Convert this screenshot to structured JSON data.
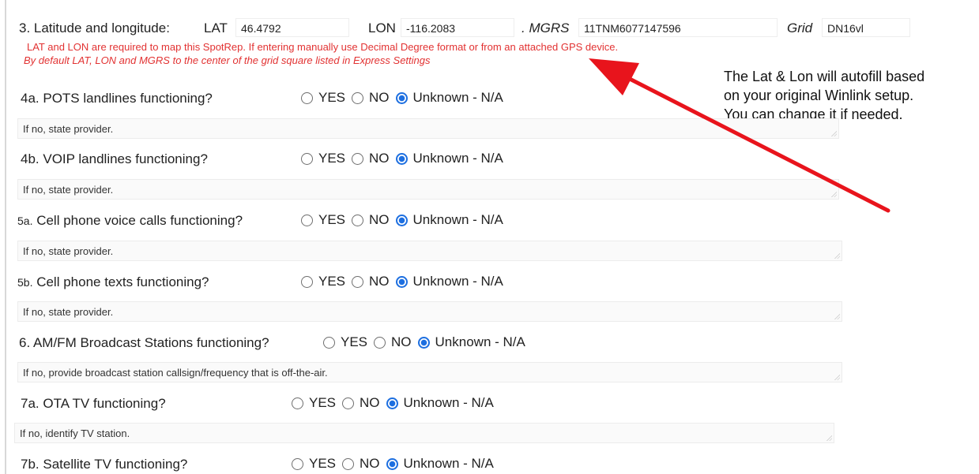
{
  "q3": {
    "label": "3. Latitude and longitude:",
    "lat_label": "LAT",
    "lat_value": "46.4792",
    "lon_label": "LON",
    "lon_value": "-116.2083",
    "mgrs_label": ". MGRS",
    "mgrs_value": "11TNM6077147596",
    "grid_label": "Grid",
    "grid_value": "DN16vl",
    "note1": "LAT and LON are required to map this SpotRep. If entering manually use Decimal Degree format or from an attached GPS device.",
    "note2": "By default  LAT, LON and MGRS to the center of the grid square listed in Express Settings"
  },
  "options": {
    "yes": "YES",
    "no": "NO",
    "unknown": "Unknown - N/A"
  },
  "questions": [
    {
      "label": "4a. POTS landlines functioning?",
      "placeholder": "If no, state provider.",
      "selected": "unknown"
    },
    {
      "label": "4b. VOIP landlines functioning?",
      "placeholder": "If no, state provider.",
      "selected": "unknown"
    },
    {
      "label_prefix": "5a.",
      "label": " Cell phone voice calls functioning?",
      "placeholder": "If no, state provider.",
      "selected": "unknown"
    },
    {
      "label_prefix": "5b.",
      "label": " Cell phone texts functioning?",
      "placeholder": "If no, state provider.",
      "selected": "unknown"
    },
    {
      "label": "6. AM/FM Broadcast Stations functioning?",
      "placeholder": "If no, provide broadcast station callsign/frequency that is off-the-air.",
      "selected": "unknown"
    },
    {
      "label": "7a. OTA TV functioning?",
      "placeholder": "If no, identify TV station.",
      "selected": "unknown"
    },
    {
      "label": "7b. Satellite TV functioning?",
      "selected": "unknown"
    }
  ],
  "callout": {
    "line1": "The Lat & Lon will autofill based",
    "line2": "on your original Winlink setup.",
    "line3": "You can change it if needed."
  },
  "colors": {
    "note": "#e23232",
    "arrow": "#e8141c",
    "radio_selected": "#1d6fe0"
  }
}
